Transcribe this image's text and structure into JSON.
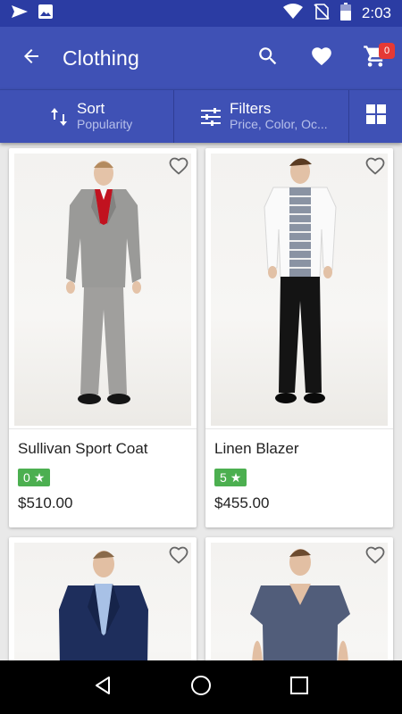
{
  "status_bar": {
    "time": "2:03",
    "icons": [
      "send-icon",
      "image-icon",
      "wifi-icon",
      "no-sim-icon",
      "battery-icon"
    ]
  },
  "app_bar": {
    "title": "Clothing",
    "cart_count": "0",
    "icons": [
      "back-arrow-icon",
      "search-icon",
      "heart-icon",
      "cart-icon"
    ]
  },
  "filter_bar": {
    "sort_label": "Sort",
    "sort_value": "Popularity",
    "filters_label": "Filters",
    "filters_value": "Price, Color, Oc..."
  },
  "products": [
    {
      "name": "Sullivan Sport Coat",
      "rating": "0",
      "price": "$510.00"
    },
    {
      "name": "Linen Blazer",
      "rating": "5",
      "price": "$455.00"
    },
    {
      "name": "",
      "rating": "",
      "price": ""
    },
    {
      "name": "",
      "rating": "",
      "price": ""
    }
  ],
  "colors": {
    "status_bar": "#2b3ca3",
    "app_bar": "#3f51b5",
    "rating_badge": "#4caf50",
    "cart_badge": "#e53935"
  }
}
